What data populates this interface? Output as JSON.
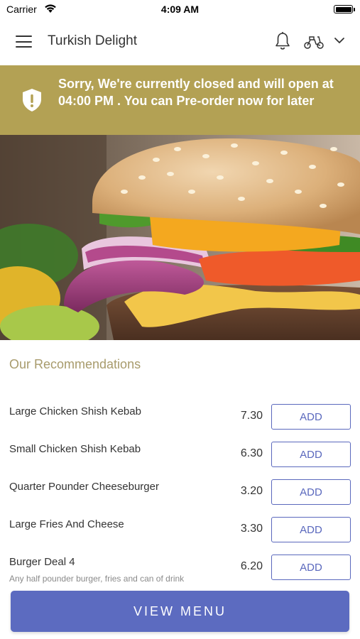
{
  "status_bar": {
    "carrier": "Carrier",
    "time": "4:09 AM"
  },
  "header": {
    "title": "Turkish Delight",
    "icons": [
      "menu-icon",
      "bell-icon",
      "delivery-scooter-icon",
      "chevron-down-icon"
    ]
  },
  "notice": {
    "text": "Sorry, We're currently closed and will open at 04:00 PM . You can Pre-order now for later",
    "icon": "shield-alert-icon",
    "background": "#b3a154"
  },
  "recommendations": {
    "title": "Our Recommendations",
    "items": [
      {
        "name": "Large Chicken Shish Kebab",
        "price": "7.30",
        "button": "ADD"
      },
      {
        "name": "Small Chicken Shish Kebab",
        "price": "6.30",
        "button": "ADD"
      },
      {
        "name": "Quarter Pounder Cheeseburger",
        "price": "3.20",
        "button": "ADD"
      },
      {
        "name": "Large Fries And Cheese",
        "price": "3.30",
        "button": "ADD"
      },
      {
        "name": "Burger Deal 4",
        "description": "Any half pounder burger, fries and can of drink",
        "price": "6.20",
        "button": "ADD"
      }
    ]
  },
  "footer": {
    "view_menu_label": "VIEW MENU",
    "accent": "#5c6bc0"
  }
}
